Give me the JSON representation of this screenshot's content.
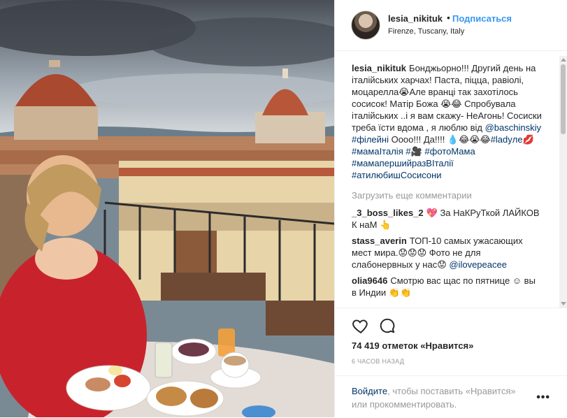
{
  "header": {
    "username": "lesia_nikituk",
    "dot": "•",
    "follow_label": "Подписаться",
    "location": "Firenze, Tuscany, Italy"
  },
  "caption": {
    "username": "lesia_nikituk",
    "text_1": "Бонджьорно!!! Другий день на італійських харчах! Паста, піцца, равіолі, моцарелла😭Але вранці так захотілось сосисок! Матір Божа 😭😂 Спробувала італійських ..і я вам скажу- НеАгонь! Сосиски треба їсти вдома , я люблю від ",
    "mention": "@baschinskiy",
    "text_2": " ",
    "tag_1": "#філейні",
    "text_3": " Оооо!!! Да!!!! 💧😂😭😂",
    "tag_2": "#ladyле",
    "text_4": "💋 ",
    "tag_3": "#мамаІталія",
    "text_5": " ",
    "tag_4": "#🎥",
    "text_6": " ",
    "tag_5": "#фотоМама",
    "text_7": " ",
    "tag_6": "#мамапершийразВІталії",
    "text_8": " ",
    "tag_7": "#атилюбишСосисони"
  },
  "load_more_label": "Загрузить еще комментарии",
  "comments": [
    {
      "username": "_3_boss_likes_2",
      "text": "💖 За НаКРуТкой ЛАЙКОВ К наМ 👆"
    },
    {
      "username": "stass_averin",
      "text": "ТОП-10 самых ужасающих мест мира.😟😟😟 Фото не для слабонервных у нас😟 ",
      "mention": "@ilovepeacee"
    },
    {
      "username": "olia9646",
      "text": "Смотрю вас щас по пятнице ☺ вы в Индии 👏👏"
    }
  ],
  "likes_label": "74 419 отметок «Нравится»",
  "time_label": "6 ЧАСОВ НАЗАД",
  "add_comment": {
    "login_label": "Войдите",
    "text": ", чтобы поставить «Нравится» или прокомментировать."
  },
  "more_label": "•••",
  "icons": {
    "heart": "heart-icon",
    "comment": "comment-bubble-icon",
    "more": "more-options-icon"
  },
  "colors": {
    "link": "#3897f0",
    "tag": "#003569",
    "muted": "#999999"
  }
}
